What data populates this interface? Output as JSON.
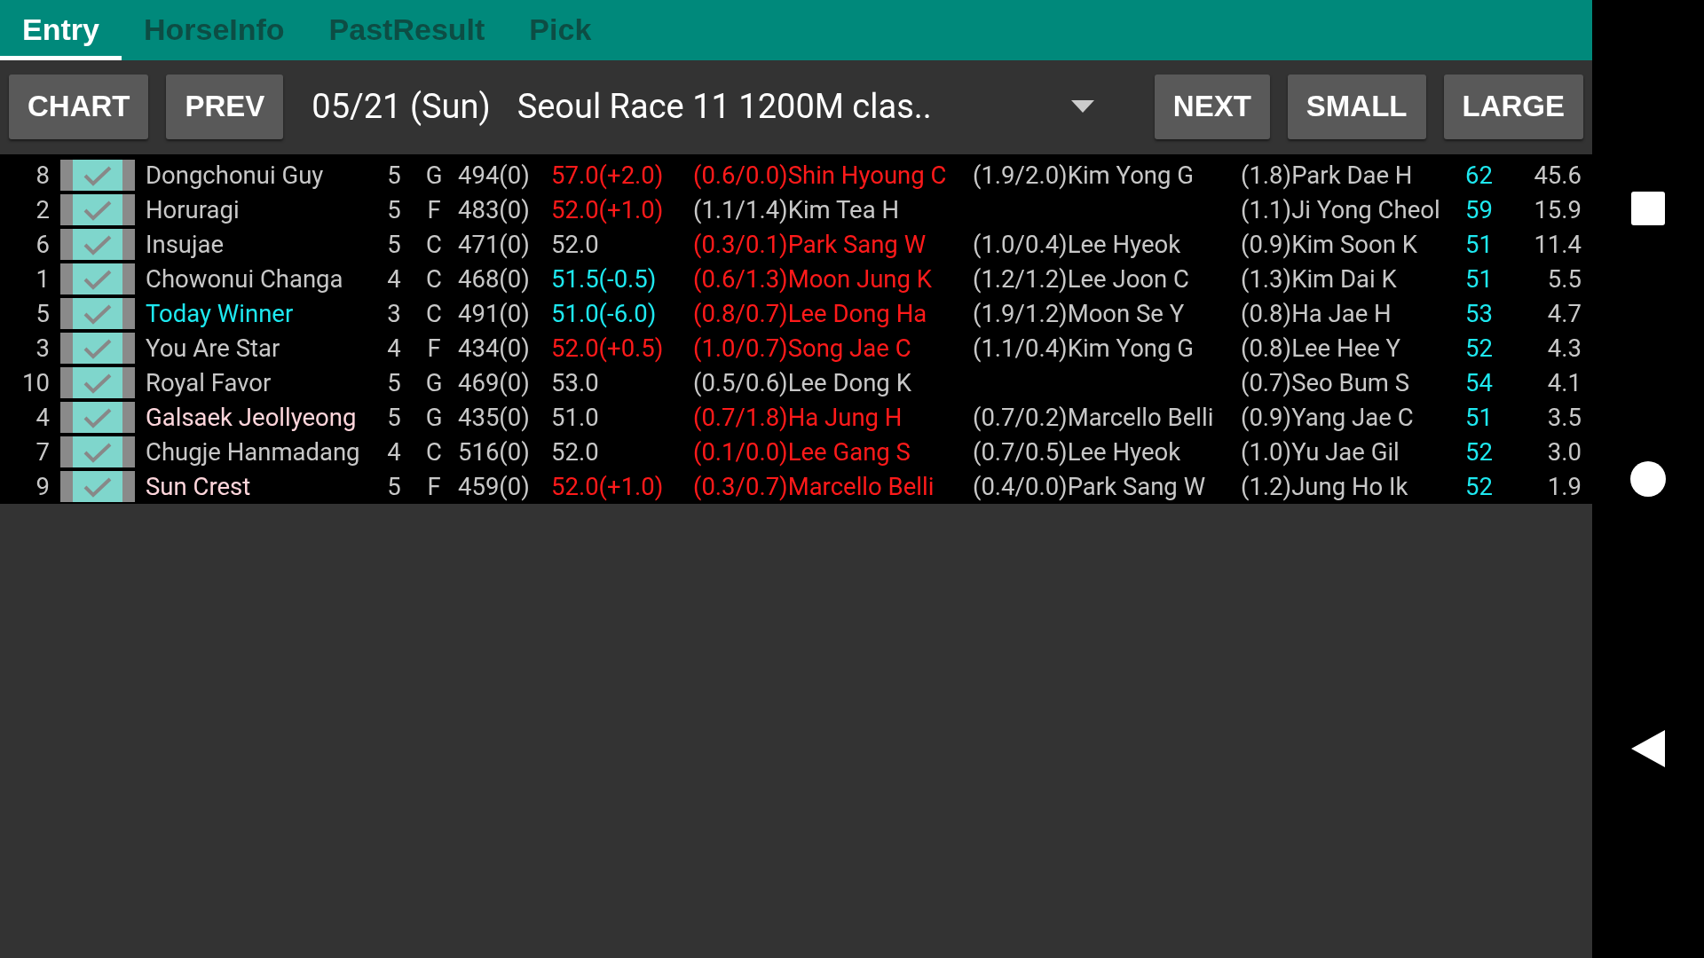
{
  "tabs": [
    {
      "label": "Entry",
      "selected": true
    },
    {
      "label": "HorseInfo",
      "selected": false
    },
    {
      "label": "PastResult",
      "selected": false
    },
    {
      "label": "Pick",
      "selected": false
    }
  ],
  "toolbar": {
    "left_buttons": [
      "CHART",
      "PREV"
    ],
    "date": "05/21 (Sun)",
    "race": "Seoul Race 11 1200M  clas..",
    "right_buttons": [
      "NEXT",
      "SMALL",
      "LARGE"
    ]
  },
  "rows": [
    {
      "number": "8",
      "checked": true,
      "name": {
        "text": "Dongchonui Guy",
        "color": "#c8c8c8"
      },
      "age": "5",
      "sex": "G",
      "weight": "494(0)",
      "burden": {
        "text": "57.0(+2.0)",
        "color": "#ff1a1a"
      },
      "jockey": {
        "text": "(0.6/0.0)Shin Hyoung C",
        "color": "#ff1a1a"
      },
      "trainer": "(1.9/2.0)Kim Yong G",
      "column_10": "(1.8)Park Dae H",
      "rating": "62",
      "odds": "45.6"
    },
    {
      "number": "2",
      "checked": true,
      "name": {
        "text": "Horuragi",
        "color": "#c8c8c8"
      },
      "age": "5",
      "sex": "F",
      "weight": "483(0)",
      "burden": {
        "text": "52.0(+1.0)",
        "color": "#ff1a1a"
      },
      "jockey": {
        "text": "(1.1/1.4)Kim Tea H",
        "color": "#c8c8c8"
      },
      "column_10": "(1.1)Ji Yong Cheol",
      "rating": "59",
      "odds": "15.9"
    },
    {
      "number": "6",
      "checked": true,
      "name": {
        "text": "Insujae",
        "color": "#c8c8c8"
      },
      "age": "5",
      "sex": "C",
      "weight": "471(0)",
      "burden": {
        "text": "52.0",
        "color": "#c8c8c8"
      },
      "jockey": {
        "text": "(0.3/0.1)Park Sang W",
        "color": "#ff1a1a"
      },
      "trainer": "(1.0/0.4)Lee Hyeok",
      "column_10": "(0.9)Kim Soon K",
      "rating": "51",
      "odds": "11.4"
    },
    {
      "number": "1",
      "checked": true,
      "name": {
        "text": "Chowonui Changa",
        "color": "#c8c8c8"
      },
      "age": "4",
      "sex": "C",
      "weight": "468(0)",
      "burden": {
        "text": "51.5(-0.5)",
        "color": "#1ee8f0"
      },
      "jockey": {
        "text": "(0.6/1.3)Moon Jung K",
        "color": "#ff1a1a"
      },
      "trainer": "(1.2/1.2)Lee Joon C",
      "column_10": "(1.3)Kim Dai K",
      "rating": "51",
      "odds": "5.5"
    },
    {
      "number": "5",
      "checked": true,
      "name": {
        "text": "Today Winner",
        "color": "#1ee8f0"
      },
      "age": "3",
      "sex": "C",
      "weight": "491(0)",
      "burden": {
        "text": "51.0(-6.0)",
        "color": "#1ee8f0"
      },
      "jockey": {
        "text": "(0.8/0.7)Lee Dong Ha",
        "color": "#ff1a1a"
      },
      "trainer": "(1.9/1.2)Moon Se Y",
      "column_10": "(0.8)Ha Jae H",
      "rating": "53",
      "odds": "4.7"
    },
    {
      "number": "3",
      "checked": true,
      "name": {
        "text": "You Are Star",
        "color": "#c8c8c8"
      },
      "age": "4",
      "sex": "F",
      "weight": "434(0)",
      "burden": {
        "text": "52.0(+0.5)",
        "color": "#ff1a1a"
      },
      "jockey": {
        "text": "(1.0/0.7)Song Jae C",
        "color": "#ff1a1a"
      },
      "trainer": "(1.1/0.4)Kim Yong G",
      "column_10": "(0.8)Lee Hee Y",
      "rating": "52",
      "odds": "4.3"
    },
    {
      "number": "10",
      "checked": true,
      "name": {
        "text": "Royal Favor",
        "color": "#c8c8c8"
      },
      "age": "5",
      "sex": "G",
      "weight": "469(0)",
      "burden": {
        "text": "53.0",
        "color": "#c8c8c8"
      },
      "jockey": {
        "text": "(0.5/0.6)Lee Dong K",
        "color": "#c8c8c8"
      },
      "column_10": "(0.7)Seo Bum S",
      "rating": "54",
      "odds": "4.1"
    },
    {
      "number": "4",
      "checked": true,
      "name": {
        "text": "Galsaek Jeollyeong",
        "color": "#ffd6dc"
      },
      "age": "5",
      "sex": "G",
      "weight": "435(0)",
      "burden": {
        "text": "51.0",
        "color": "#c8c8c8"
      },
      "jockey": {
        "text": "(0.7/1.8)Ha Jung H",
        "color": "#ff1a1a"
      },
      "trainer": "(0.7/0.2)Marcello Belli",
      "column_10": "(0.9)Yang Jae C",
      "rating": "51",
      "odds": "3.5"
    },
    {
      "number": "7",
      "checked": true,
      "name": {
        "text": "Chugje Hanmadang",
        "color": "#c8c8c8"
      },
      "age": "4",
      "sex": "C",
      "weight": "516(0)",
      "burden": {
        "text": "52.0",
        "color": "#c8c8c8"
      },
      "jockey": {
        "text": "(0.1/0.0)Lee Gang S",
        "color": "#ff1a1a"
      },
      "trainer": "(0.7/0.5)Lee Hyeok",
      "column_10": "(1.0)Yu Jae Gil",
      "rating": "52",
      "odds": "3.0"
    },
    {
      "number": "9",
      "checked": true,
      "name": {
        "text": "Sun Crest",
        "color": "#ffd6dc"
      },
      "age": "5",
      "sex": "F",
      "weight": "459(0)",
      "burden": {
        "text": "52.0(+1.0)",
        "color": "#ff1a1a"
      },
      "jockey": {
        "text": "(0.3/0.7)Marcello Belli",
        "color": "#ff1a1a"
      },
      "trainer": "(0.4/0.0)Park Sang W",
      "column_10": "(1.2)Jung Ho Ik",
      "rating": "52",
      "odds": "1.9"
    }
  ]
}
